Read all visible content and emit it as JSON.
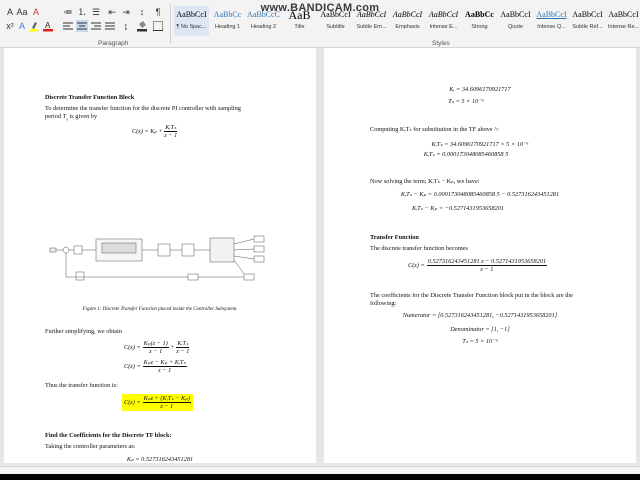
{
  "watermark": "www.BANDICAM.com",
  "ribbon": {
    "group_paragraph": "Paragraph",
    "group_styles": "Styles",
    "styles": [
      {
        "sample": "AaBbCcI",
        "name": "¶ No Spac..."
      },
      {
        "sample": "AaBbCc",
        "name": "Heading 1"
      },
      {
        "sample": "AaBbCcC",
        "name": "Heading 2"
      },
      {
        "sample": "AaB",
        "name": "Title"
      },
      {
        "sample": "AaBbCcI",
        "name": "Subtitle"
      },
      {
        "sample": "AaBbCcI",
        "name": "Subtle Em..."
      },
      {
        "sample": "AaBbCcI",
        "name": "Emphasis"
      },
      {
        "sample": "AaBbCcI",
        "name": "Intense E..."
      },
      {
        "sample": "AaBbCc",
        "name": "Strong"
      },
      {
        "sample": "AaBbCcI",
        "name": "Quote"
      },
      {
        "sample": "AaBbCcI",
        "name": "Intense Q..."
      },
      {
        "sample": "AaBbCcI",
        "name": "Subtle Ref..."
      },
      {
        "sample": "AaBbCcI",
        "name": "Intense Re..."
      }
    ]
  },
  "left_page": {
    "heading1": "Discrete Transfer Function Block",
    "para1_line1": "To determine the transfer function for the discrete PI controller with sampling",
    "para1_line2_a": "period",
    "para1_line2_var": "T",
    "para1_line2_sub": "s",
    "para1_line2_b": "is given by",
    "eq1_lhs": "C(z) = K",
    "eq1_lhs_sub": "p",
    "eq1_plus": "+",
    "eq1_num": "KᵢTₛ",
    "eq1_den": "z − 1",
    "figure_caption": "Figure 1: Discrete Transfer Function placed inside the Controller Subsystem.",
    "para2": "Further simplifying, we obtain",
    "eq2_lhs": "C(z) =",
    "eq2_num1": "Kₚ(z − 1)",
    "eq2_den1": "z − 1",
    "eq2_plus": "+",
    "eq2_num2": "KᵢTₛ",
    "eq2_den2": "z − 1",
    "eq3_lhs": "C(z) =",
    "eq3_num": "Kₚz − Kₚ + KᵢTₛ",
    "eq3_den": "z − 1",
    "para3": "Thus the transfer function is:",
    "eq4_lhs": "C(z) =",
    "eq4_num": "Kₚz + (KᵢTₛ − Kₚ)",
    "eq4_den": "z − 1",
    "heading2": "Find the Coefficients for the Discrete TF block:",
    "para4": "Taking the controller parameters as:",
    "kp_line": "Kₚ = 0.527316243451281"
  },
  "right_page": {
    "ki_line": "Kᵢ = 34.6096170921717",
    "ts_line": "Tₛ = 5 × 10⁻⁶",
    "para1": "Computing KᵢTₛ for substitution in the TF above ^:",
    "kits_line1": "KᵢTₛ = 34.6096170921717 × 5 × 10⁻⁶",
    "kits_line2": "KᵢTₛ = 0.000173048085460858 5",
    "para2": "Now solving the term; KᵢTₛ − Kₚ, we have:",
    "diff_line1": "KᵢTₛ − Kₚ = 0.000173048085460858 5 − 0.527316243451281",
    "diff_line2": "KᵢTₛ − Kₚ = −0.5271431953658201",
    "heading1": "Transfer Function",
    "para3": "The discrete transfer function becomes",
    "tf_lhs": "C(z) =",
    "tf_num": "0.527316243451281 z − 0.5271431953658201",
    "tf_den": "z − 1",
    "para4_line1": "The coefficients for the Discrete Transfer Function block put in the block are the",
    "para4_line2": "following:",
    "numerator_line": "Numerator = [0.527316243451281, −0.5271431953658201]",
    "denominator_line": "Denominator = [1, −1]",
    "ts2_line": "Tₛ = 5 × 10⁻⁶"
  }
}
